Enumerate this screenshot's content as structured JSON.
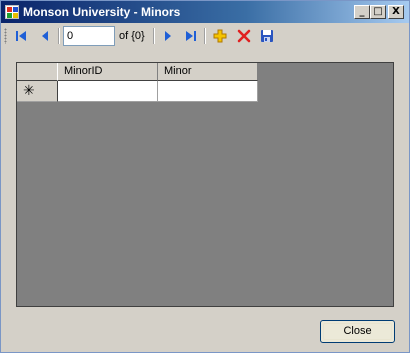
{
  "window": {
    "title": "Monson University - Minors"
  },
  "caption_buttons": {
    "minimize": "_",
    "maximize": "□",
    "close": "X"
  },
  "toolbar": {
    "position_value": "0",
    "count_text": "of {0}",
    "icons": [
      "move-first-icon",
      "move-previous-icon",
      "move-next-icon",
      "move-last-icon",
      "add-new-icon",
      "delete-icon",
      "save-icon"
    ]
  },
  "grid": {
    "columns": [
      "MinorID",
      "Minor"
    ],
    "new_row_marker": "✳",
    "rows": []
  },
  "close_button": {
    "label": "Close"
  },
  "colors": {
    "grid_background": "#808080",
    "form_background": "#d4d0c8",
    "nav_icon_blue": "#1f5fd6",
    "delete_red": "#e02020",
    "add_yellow": "#e8b000"
  }
}
